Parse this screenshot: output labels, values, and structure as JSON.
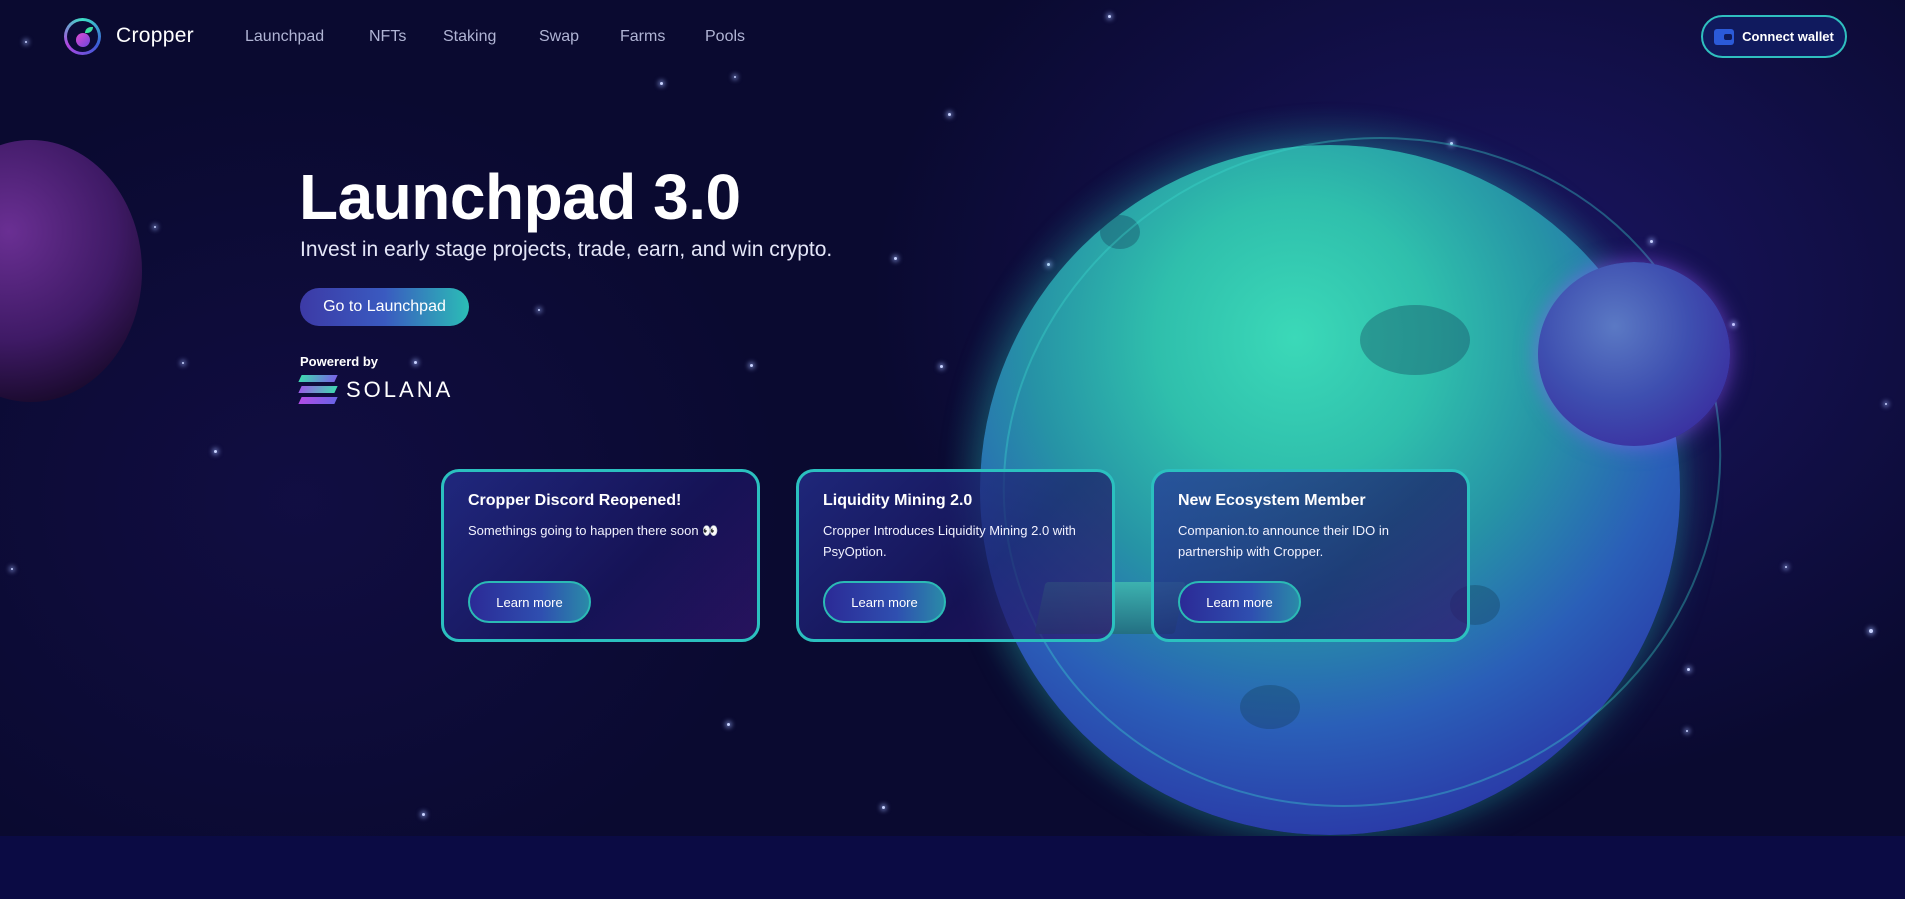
{
  "colors": {
    "accent_teal": "#2bc0bf",
    "background": "#0a0a30",
    "nav_text": "#b0b4d4",
    "card_border": "#2bc0bf"
  },
  "navbar": {
    "brand": "Cropper",
    "logo_icon": "cropper-logo-icon",
    "links": [
      {
        "label": "Launchpad"
      },
      {
        "label": "NFTs"
      },
      {
        "label": "Staking"
      },
      {
        "label": "Swap"
      },
      {
        "label": "Farms"
      },
      {
        "label": "Pools"
      }
    ],
    "connect_label": "Connect wallet",
    "connect_icon": "wallet-icon"
  },
  "hero": {
    "title": "Launchpad 3.0",
    "subtitle": "Invest in early stage projects, trade, earn, and win crypto.",
    "cta_label": "Go to Launchpad",
    "powered_label": "Powererd by",
    "powered_brand": "SOLANA",
    "powered_icon": "solana-logo-icon"
  },
  "cards": [
    {
      "title": "Cropper Discord Reopened!",
      "body": "Somethings going to happen there soon 👀",
      "button": "Learn more"
    },
    {
      "title": "Liquidity Mining 2.0",
      "body": "Cropper Introduces Liquidity Mining 2.0 with PsyOption.",
      "button": "Learn more"
    },
    {
      "title": "New Ecosystem Member",
      "body": "Companion.to announce their IDO in partnership with Cropper.",
      "button": "Learn more"
    }
  ]
}
